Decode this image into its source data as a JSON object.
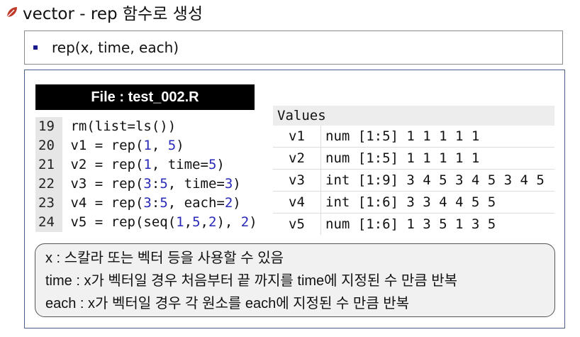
{
  "header": {
    "title": "vector - rep 함수로 생성",
    "icon": "leaf-icon"
  },
  "bullet": {
    "text": "rep(x, time, each)"
  },
  "file": {
    "title": "File : test_002.R"
  },
  "code": {
    "lines": [
      {
        "no": "19",
        "parts": [
          {
            "t": "rm(list=ls())",
            "n": false
          }
        ]
      },
      {
        "no": "20",
        "parts": [
          {
            "t": "v1 = rep(",
            "n": false
          },
          {
            "t": "1",
            "n": true
          },
          {
            "t": ", ",
            "n": false
          },
          {
            "t": "5",
            "n": true
          },
          {
            "t": ")",
            "n": false
          }
        ]
      },
      {
        "no": "21",
        "parts": [
          {
            "t": "v2 = rep(",
            "n": false
          },
          {
            "t": "1",
            "n": true
          },
          {
            "t": ", time=",
            "n": false
          },
          {
            "t": "5",
            "n": true
          },
          {
            "t": ")",
            "n": false
          }
        ]
      },
      {
        "no": "22",
        "parts": [
          {
            "t": "v3 = rep(",
            "n": false
          },
          {
            "t": "3",
            "n": true
          },
          {
            "t": ":",
            "n": false
          },
          {
            "t": "5",
            "n": true
          },
          {
            "t": ", time=",
            "n": false
          },
          {
            "t": "3",
            "n": true
          },
          {
            "t": ")",
            "n": false
          }
        ]
      },
      {
        "no": "23",
        "parts": [
          {
            "t": "v4 = rep(",
            "n": false
          },
          {
            "t": "3",
            "n": true
          },
          {
            "t": ":",
            "n": false
          },
          {
            "t": "5",
            "n": true
          },
          {
            "t": ", each=",
            "n": false
          },
          {
            "t": "2",
            "n": true
          },
          {
            "t": ")",
            "n": false
          }
        ]
      },
      {
        "no": "24",
        "parts": [
          {
            "t": "v5 = rep(seq(",
            "n": false
          },
          {
            "t": "1",
            "n": true
          },
          {
            "t": ",",
            "n": false
          },
          {
            "t": "5",
            "n": true
          },
          {
            "t": ",",
            "n": false
          },
          {
            "t": "2",
            "n": true
          },
          {
            "t": "), ",
            "n": false
          },
          {
            "t": "2",
            "n": true
          },
          {
            "t": ")",
            "n": false
          }
        ]
      }
    ]
  },
  "values": {
    "header": "Values",
    "rows": [
      {
        "name": "v1",
        "value": "num [1:5] 1 1 1 1 1"
      },
      {
        "name": "v2",
        "value": "num [1:5] 1 1 1 1 1"
      },
      {
        "name": "v3",
        "value": "int [1:9] 3 4 5 3 4 5 3 4 5"
      },
      {
        "name": "v4",
        "value": "int [1:6] 3 3 4 4 5 5"
      },
      {
        "name": "v5",
        "value": "num [1:6] 1 3 5 1 3 5"
      }
    ]
  },
  "notes": [
    "x : 스칼라 또는 벡터 등을 사용할 수 있음",
    "time : x가 벡터일 경우 처음부터 끝 까지를 time에 지정된 수 만큼 반복",
    "each : x가 벡터일 경우 각 원소를 each에 지정된 수 만큼 반복"
  ],
  "colors": {
    "code_number": "#2929b8",
    "content_border": "#4d5e8a",
    "icon": "#c0392b"
  }
}
